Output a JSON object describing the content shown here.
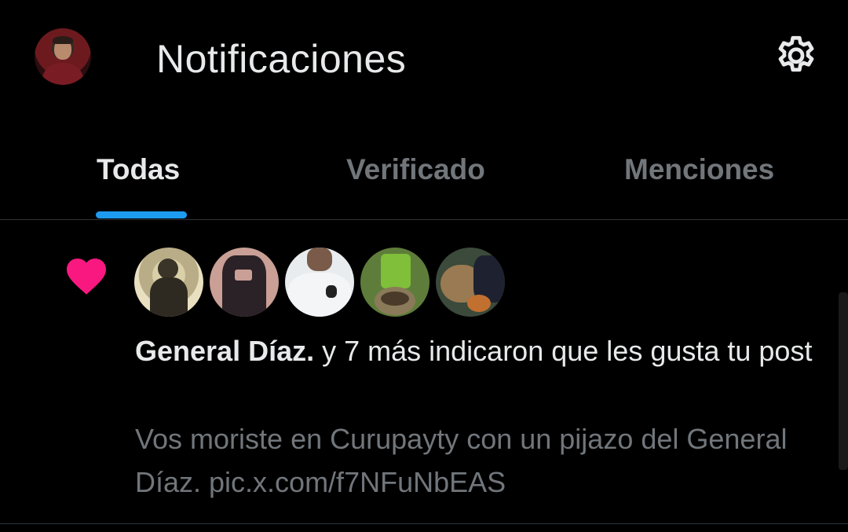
{
  "header": {
    "title": "Notificaciones",
    "avatar_icon": "user-avatar",
    "settings_icon": "gear-icon"
  },
  "tabs": [
    {
      "label": "Todas",
      "active": true
    },
    {
      "label": "Verificado",
      "active": false
    },
    {
      "label": "Menciones",
      "active": false
    }
  ],
  "notification": {
    "type_icon": "heart-icon",
    "icon_color": "#f91880",
    "who": "General Díaz.",
    "rest": " y 7 más indicaron que les gusta tu post",
    "snippet": "Vos moriste en Curupayty con un pijazo del General Díaz. pic.x.com/f7NFuNbEAS",
    "likers": [
      "liker-avatar-1",
      "liker-avatar-2",
      "liker-avatar-3",
      "liker-avatar-4",
      "liker-avatar-5"
    ]
  },
  "colors": {
    "background": "#000000",
    "text_primary": "#e7e9ea",
    "text_secondary": "#71767b",
    "accent": "#1d9bf0",
    "like": "#f91880",
    "divider": "#2f3336"
  }
}
